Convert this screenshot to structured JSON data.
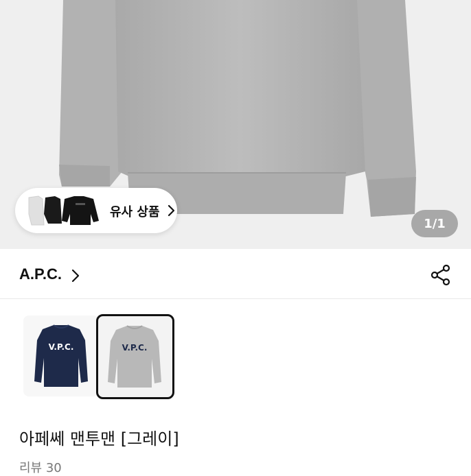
{
  "hero": {
    "similar_products_label": "유사 상품",
    "image_counter": "1/1"
  },
  "brand": {
    "name": "A.P.C."
  },
  "variants": [
    {
      "color": "#1e2a4a",
      "logo_text": "V.P.C."
    },
    {
      "color": "#b8b8b8",
      "logo_text": "V.P.C."
    }
  ],
  "product": {
    "title": "아페쎄 맨투맨 [그레이]",
    "reviews": "리뷰 30"
  },
  "colors": {
    "sweatshirt_grey": "#b9b9b9",
    "navy": "#1e2a4a",
    "accent": "#111111"
  }
}
